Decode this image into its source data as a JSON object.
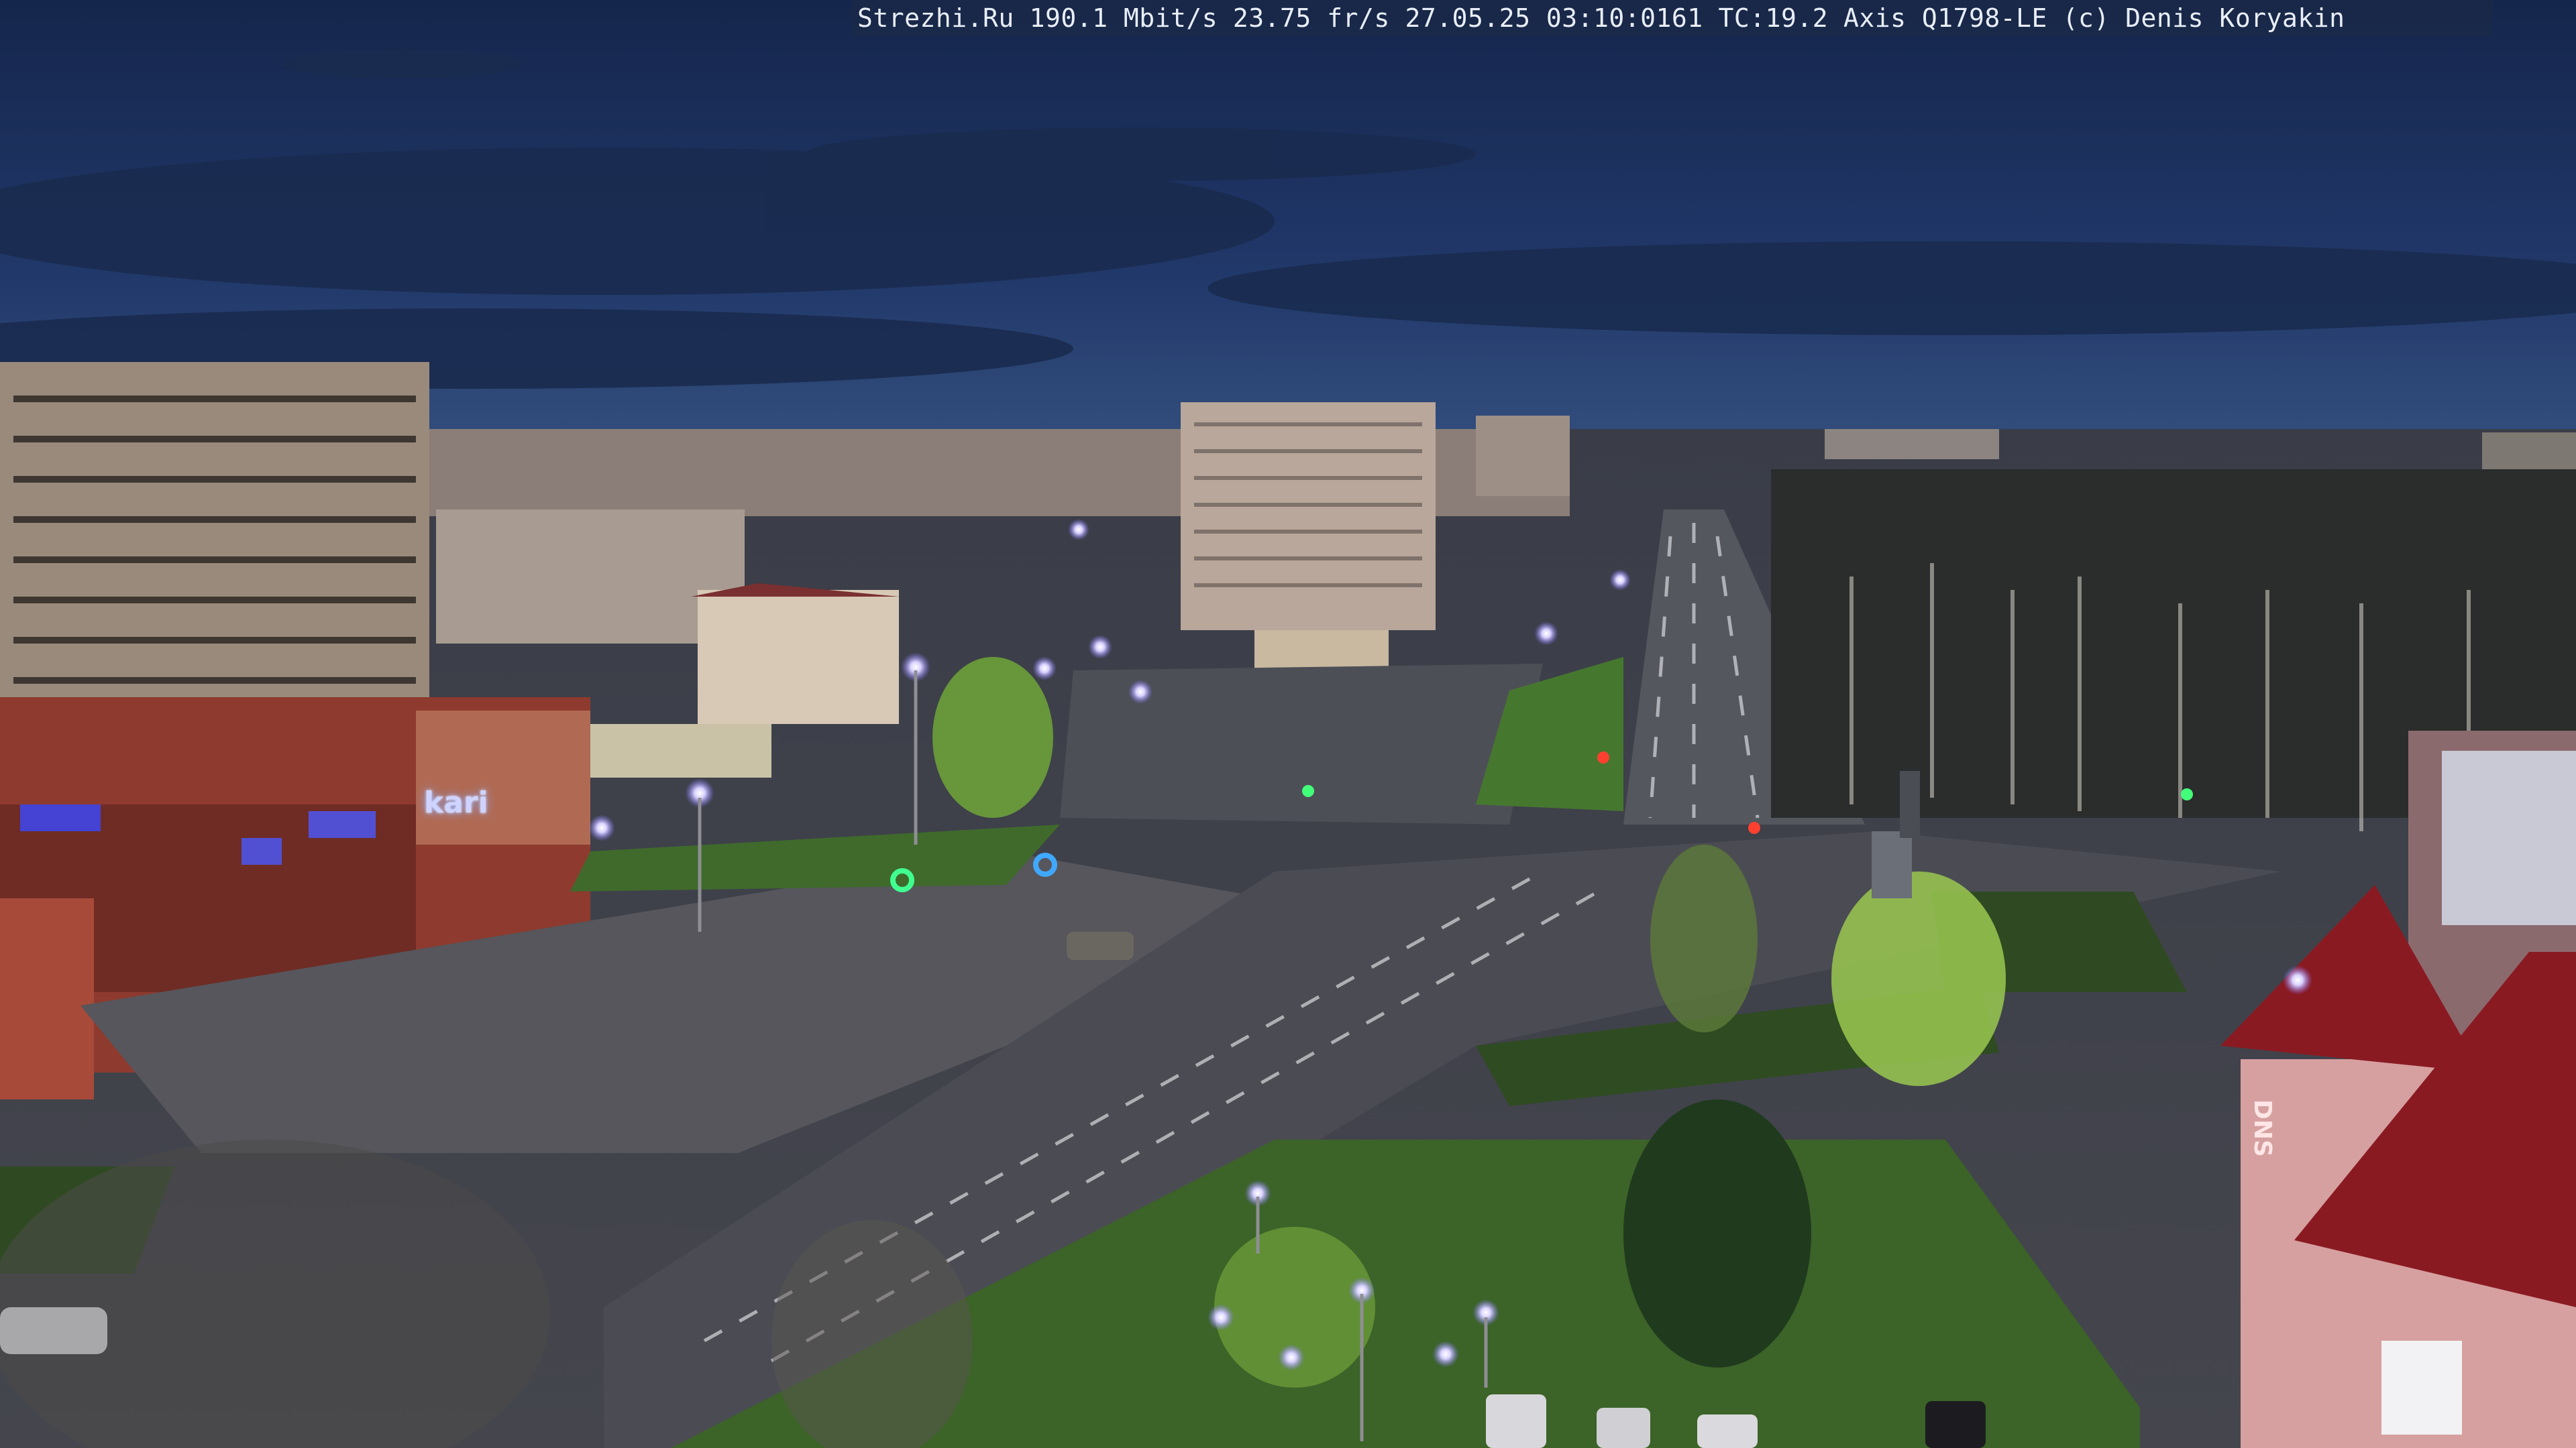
{
  "overlay": {
    "site": "Strezhi.Ru",
    "bitrate": "190.1 Mbit/s",
    "framerate": "23.75 fr/s",
    "datetime": "27.05.25 03:10:0161",
    "tc": "TC:19.2",
    "camera": "Axis Q1798-LE",
    "copyright": "(c) Denis Koryakin"
  },
  "signs": {
    "store_left": "kari",
    "store_right": "DNS"
  },
  "palette": {
    "sky_top": "#14254a",
    "sky_horizon": "#2e4a78",
    "road": "#4a4b52",
    "grass": "#3f6a2c",
    "streetlight": "#d8d0ff"
  }
}
